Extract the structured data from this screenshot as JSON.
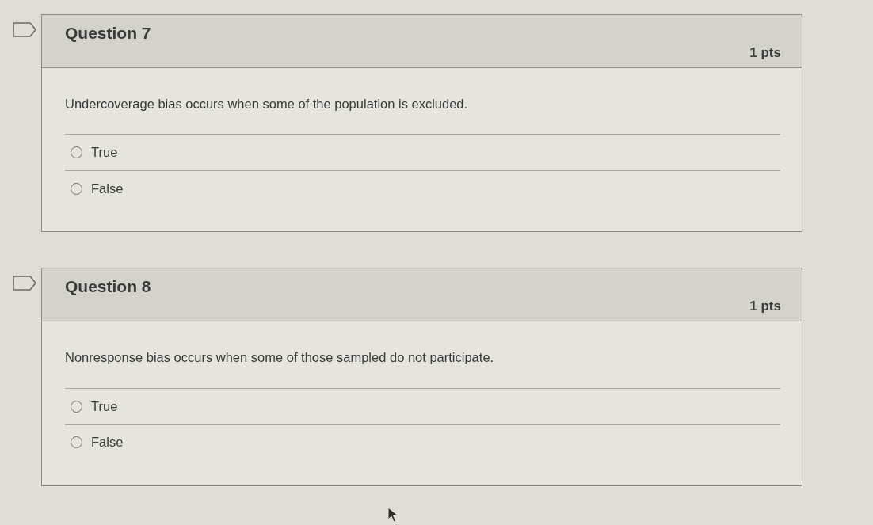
{
  "questions": [
    {
      "title": "Question 7",
      "points": "1 pts",
      "flagged": false,
      "text": "Undercoverage bias occurs when some of the population is excluded.",
      "answers": [
        {
          "label": "True",
          "selected": false
        },
        {
          "label": "False",
          "selected": false
        }
      ]
    },
    {
      "title": "Question 8",
      "points": "1 pts",
      "flagged": false,
      "text": "Nonresponse bias occurs when some of those sampled do not participate.",
      "answers": [
        {
          "label": "True",
          "selected": false
        },
        {
          "label": "False",
          "selected": false
        }
      ]
    }
  ]
}
